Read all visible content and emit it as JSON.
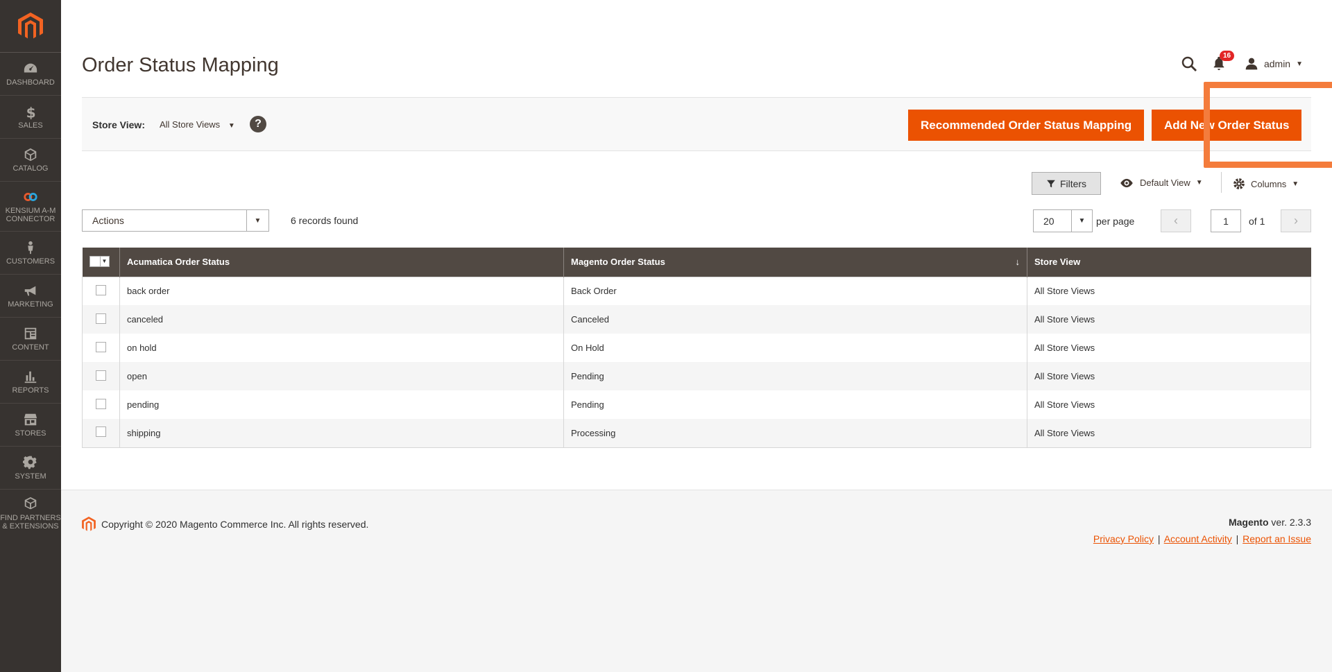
{
  "sidebar": {
    "items": [
      {
        "label": "Dashboard"
      },
      {
        "label": "Sales"
      },
      {
        "label": "Catalog"
      },
      {
        "label": "Kensium A-M Connector"
      },
      {
        "label": "Customers"
      },
      {
        "label": "Marketing"
      },
      {
        "label": "Content"
      },
      {
        "label": "Reports"
      },
      {
        "label": "Stores"
      },
      {
        "label": "System"
      },
      {
        "label": "Find Partners & Extensions"
      }
    ]
  },
  "header": {
    "title": "Order Status Mapping",
    "notifications_count": "16",
    "user": "admin"
  },
  "actions_bar": {
    "store_view_label": "Store View:",
    "store_view_value": "All Store Views",
    "help": "?",
    "recommend_button": "Recommended Order Status Mapping",
    "add_button": "Add New Order Status"
  },
  "toolbar": {
    "filters": "Filters",
    "view": "Default View",
    "columns": "Columns",
    "actions": "Actions",
    "records_found": "6 records found",
    "per_page_value": "20",
    "per_page_label": "per page",
    "page": "1",
    "of_pages": "of 1"
  },
  "grid": {
    "columns": [
      "Acumatica Order Status",
      "Magento Order Status",
      "Store View"
    ],
    "sort_indicator": "↓",
    "rows": [
      {
        "acumatica": "back order",
        "magento": "Back Order",
        "store": "All Store Views"
      },
      {
        "acumatica": "canceled",
        "magento": "Canceled",
        "store": "All Store Views"
      },
      {
        "acumatica": "on hold",
        "magento": "On Hold",
        "store": "All Store Views"
      },
      {
        "acumatica": "open",
        "magento": "Pending",
        "store": "All Store Views"
      },
      {
        "acumatica": "pending",
        "magento": "Pending",
        "store": "All Store Views"
      },
      {
        "acumatica": "shipping",
        "magento": "Processing",
        "store": "All Store Views"
      }
    ]
  },
  "footer": {
    "copyright": "Copyright © 2020 Magento Commerce Inc. All rights reserved.",
    "brand": "Magento",
    "version": "ver. 2.3.3",
    "links": [
      "Privacy Policy",
      "Account Activity",
      "Report an Issue"
    ]
  },
  "colors": {
    "accent": "#eb5202",
    "sidebar_bg": "#373330",
    "grid_header": "#514943",
    "highlight": "#f47c3c"
  }
}
